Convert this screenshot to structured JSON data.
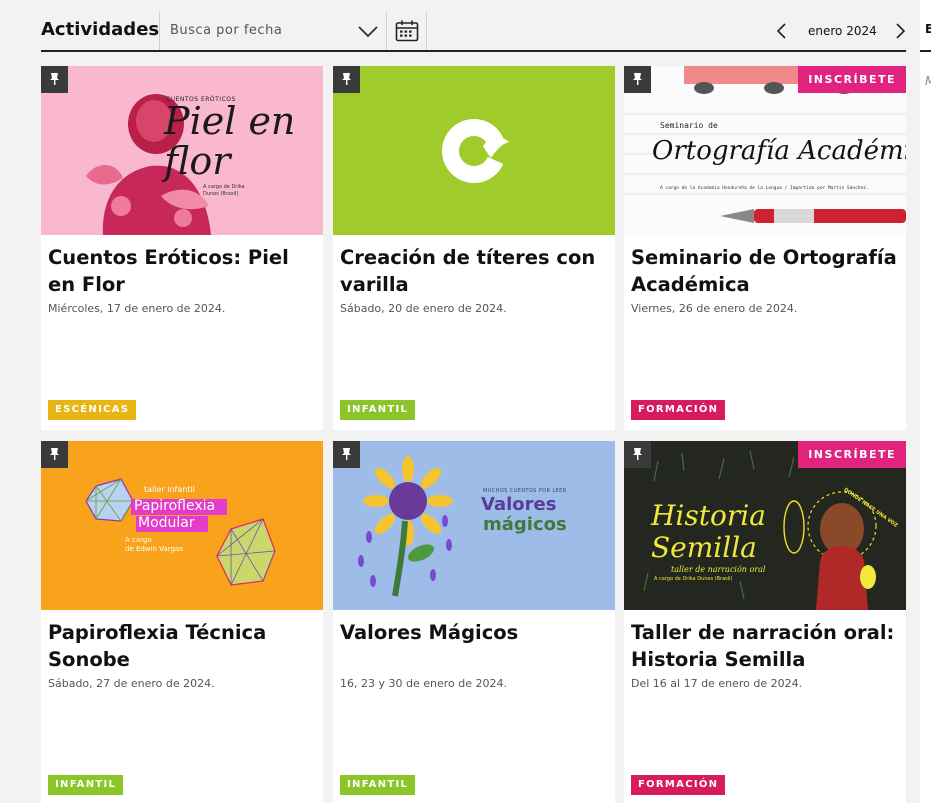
{
  "header": {
    "title": "Actividades",
    "date_placeholder": "Busca por fecha",
    "month_label": "enero 2024"
  },
  "right_edge": {
    "clipped_title": "E",
    "clipped_text": "M"
  },
  "cards": [
    {
      "title": "Cuentos Eróticos: Piel en Flor",
      "date": "Miércoles, 17 de enero de 2024.",
      "tag": "ESCÉNICAS",
      "image_text": {
        "kicker": "CUENTOS ERÓTICOS",
        "line1": "Piel en",
        "line2": "flor",
        "credit1": "A cargo de Drika",
        "credit2": "Dunes (Brasil)"
      }
    },
    {
      "title": "Creación de títeres con varilla",
      "date": "Sábado, 20 de enero de 2024.",
      "tag": "INFANTIL"
    },
    {
      "title": "Seminario de Ortografía Académica",
      "date": "Viernes, 26 de enero de 2024.",
      "tag": "FORMACIÓN",
      "enroll": "INSCRÍBETE",
      "image_text": {
        "kicker": "Seminario de",
        "main": "Ortografía Académica",
        "credit": "A cargo de la Academia Hondureña de la Lengua / Impartido por Martín Sánchez."
      }
    },
    {
      "title": "Papiroflexia Técnica Sonobe",
      "date": "Sábado, 27 de enero de 2024.",
      "tag": "INFANTIL",
      "image_text": {
        "kicker": "taller infantil",
        "line1": "Papiroflexia",
        "line2": "Modular",
        "credit1": "A cargo",
        "credit2": "de Edwin Vargas"
      }
    },
    {
      "title": "Valores Mágicos",
      "date": "16, 23 y 30 de enero de 2024.",
      "tag": "INFANTIL",
      "image_text": {
        "kicker": "MUCHOS CUENTOS POR LEER",
        "line1": "Valores",
        "line2": "mágicos"
      }
    },
    {
      "title": "Taller de narración oral: Historia Semilla",
      "date": "Del 16 al 17 de enero de 2024.",
      "tag": "FORMACIÓN",
      "enroll": "INSCRÍBETE",
      "image_text": {
        "line1": "Historia",
        "line2": "Semilla",
        "sub": "taller de narración oral",
        "credit": "A cargo de Drika Dunes (Brasil)",
        "ring": "DONDE NACE UNA VOZ"
      }
    }
  ],
  "colors": {
    "escenicas": "#e9b514",
    "infantil": "#8cc52a",
    "formacion": "#d81b5f",
    "enroll": "#e0247d"
  }
}
